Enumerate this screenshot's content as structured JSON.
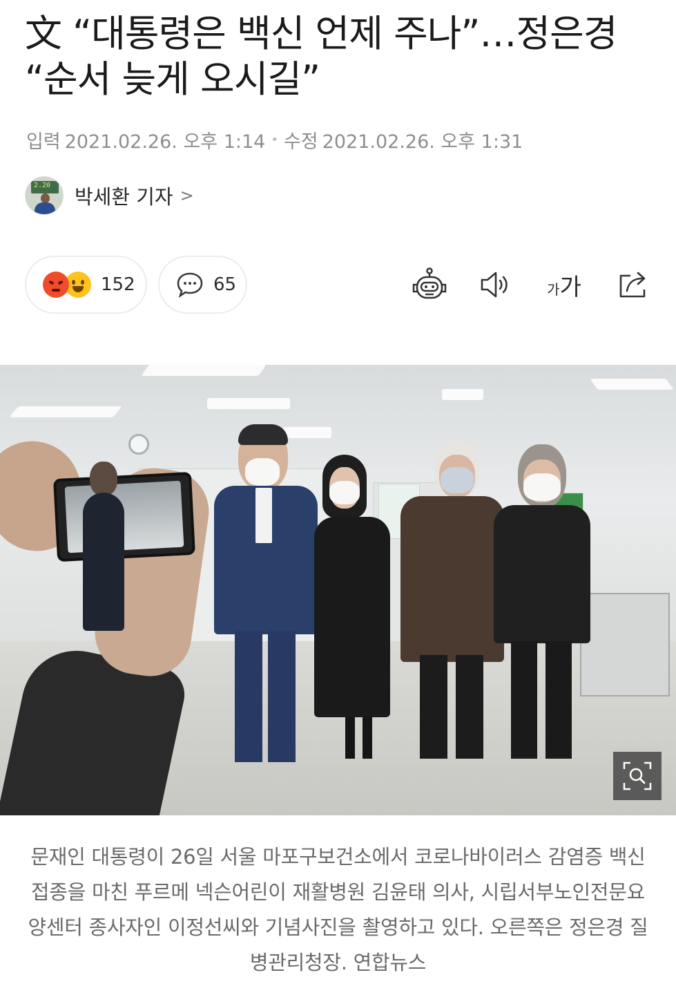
{
  "article": {
    "title": "文 “대통령은 백신 언제 주나”…정은경 “순서 늦게 오시길”",
    "input_label": "입력",
    "input_time": "2021.02.26. 오후 1:14",
    "modified_label": "수정",
    "modified_time": "2021.02.26. 오후 1:31",
    "author": "박세환 기자",
    "author_chevron": ">",
    "caption": "문재인 대통령이 26일 서울 마포구보건소에서 코로나바이러스 감염증 백신 접종을 마친 푸르메 넥슨어린이 재활병원 김윤태 의사, 시립서부노인전문요양센터 종사자인 이정선씨와 기념사진을 촬영하고 있다. 오른쪽은 정은경 질병관리청장. 연합뉴스"
  },
  "avatar": {
    "board_text": "2.20"
  },
  "actions": {
    "reactions_count": "152",
    "comments_count": "65",
    "font_small": "가",
    "font_big": "가"
  },
  "icons": {
    "reaction_1": "angry-emoji-icon",
    "reaction_2": "happy-emoji-icon",
    "comment": "speech-bubble-icon",
    "summary_bot": "robot-icon",
    "tts": "speaker-icon",
    "font_size": "font-size-icon",
    "share": "share-icon",
    "zoom": "image-zoom-icon"
  },
  "colors": {
    "meta_text": "#8e8e8e",
    "caption_text": "#6a6a6a",
    "pill_border": "#ececec",
    "angry": "#f04c2a",
    "happy": "#ffc21a"
  }
}
